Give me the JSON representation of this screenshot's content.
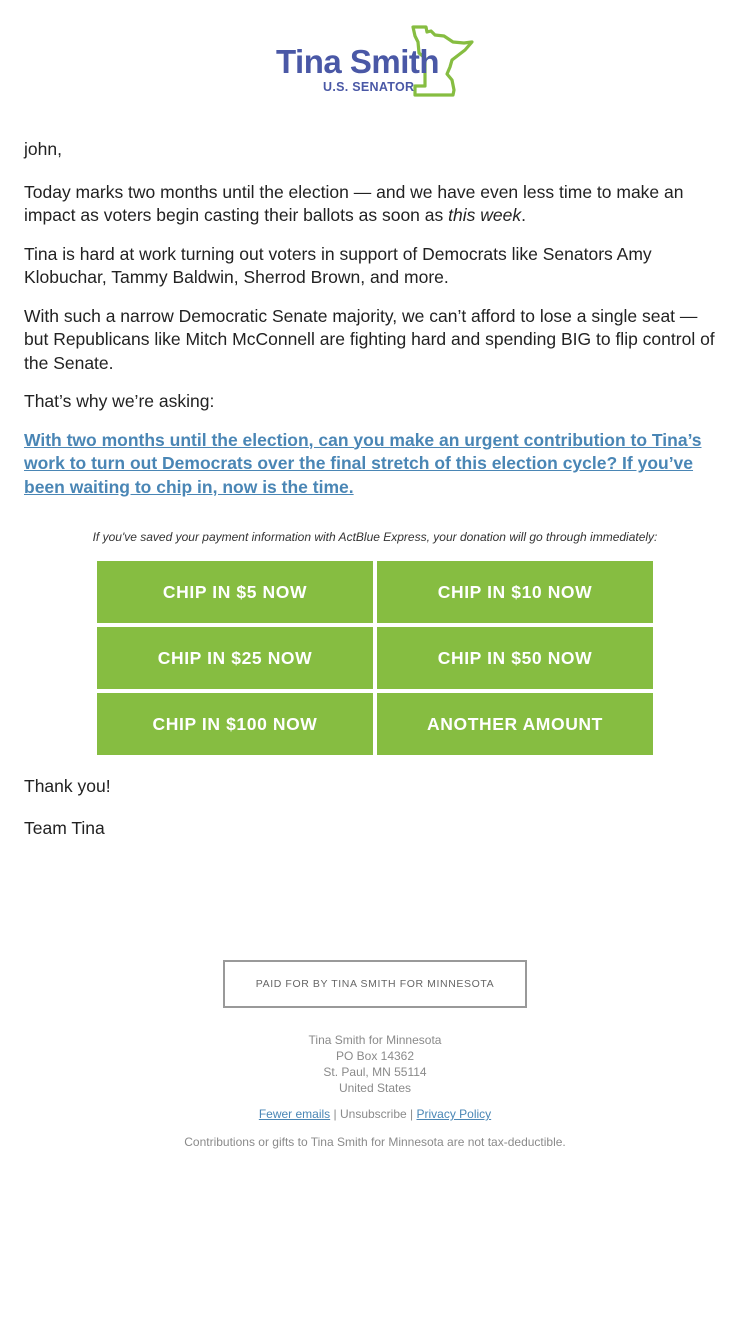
{
  "header": {
    "logo_name": "Tina Smith",
    "logo_subtitle": "U.S. SENATOR",
    "logo_icon": "minnesota-outline-icon",
    "brand_blue": "#4a58a6",
    "brand_green": "#86bd41"
  },
  "body": {
    "greeting": "john,",
    "paragraph1_main": "Today marks two months until the election — and we have even less time to make an impact as voters begin casting their ballots as soon as ",
    "paragraph1_emphasis": "this week",
    "paragraph1_end": ".",
    "paragraph2": "Tina is hard at work turning out voters in support of Democrats like Senators Amy Klobuchar, Tammy Baldwin, Sherrod Brown, and more.",
    "paragraph3": "With such a narrow Democratic Senate majority, we can’t afford to lose a single seat — but Republicans like Mitch McConnell are fighting hard and spending BIG to flip control of the Senate.",
    "paragraph4": "That’s why we’re asking:",
    "cta_link": "With two months until the election, can you make an urgent contribution to Tina’s work to turn out Democrats over the final stretch of this election cycle? If you’ve been waiting to chip in, now is the time.",
    "link_color": "#4a86b5"
  },
  "donation": {
    "express_note": "If you've saved your payment information with ActBlue Express, your donation will go through immediately:",
    "buttons": [
      {
        "label": "CHIP IN $5 NOW"
      },
      {
        "label": "CHIP IN $10 NOW"
      },
      {
        "label": "CHIP IN $25 NOW"
      },
      {
        "label": "CHIP IN $50 NOW"
      },
      {
        "label": "CHIP IN $100 NOW"
      },
      {
        "label": "ANOTHER AMOUNT"
      }
    ],
    "button_color": "#86bd41"
  },
  "closing": {
    "thanks": "Thank you!",
    "signature": "Team Tina"
  },
  "footer": {
    "paid_for": "PAID FOR BY TINA SMITH FOR MINNESOTA",
    "address_lines": [
      "Tina Smith for Minnesota",
      "PO Box 14362",
      "St. Paul, MN 55114",
      "United States"
    ],
    "links": {
      "fewer_emails": "Fewer emails",
      "separator": " | ",
      "unsubscribe": "Unsubscribe",
      "privacy_policy": "Privacy Policy"
    },
    "disclaimer": "Contributions or gifts to Tina Smith for Minnesota are not tax-deductible."
  }
}
